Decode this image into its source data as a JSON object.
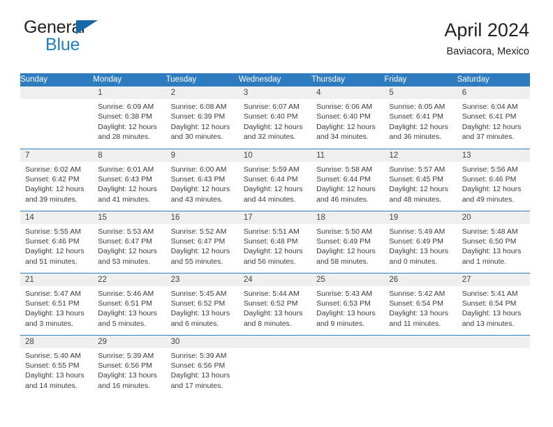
{
  "brand": {
    "name_top": "General",
    "name_bottom": "Blue",
    "logo_icon": "blue-triangle-icon",
    "accent_color": "#1f7ec4"
  },
  "header": {
    "title": "April 2024",
    "subtitle": "Baviacora, Mexico"
  },
  "calendar": {
    "header_bg": "#2e7cbf",
    "daynum_bg": "#efefef",
    "weekdays": [
      "Sunday",
      "Monday",
      "Tuesday",
      "Wednesday",
      "Thursday",
      "Friday",
      "Saturday"
    ],
    "weeks": [
      [
        {
          "day": "",
          "sunrise": "",
          "sunset": "",
          "daylight_1": "",
          "daylight_2": ""
        },
        {
          "day": "1",
          "sunrise": "Sunrise: 6:09 AM",
          "sunset": "Sunset: 6:38 PM",
          "daylight_1": "Daylight: 12 hours",
          "daylight_2": "and 28 minutes."
        },
        {
          "day": "2",
          "sunrise": "Sunrise: 6:08 AM",
          "sunset": "Sunset: 6:39 PM",
          "daylight_1": "Daylight: 12 hours",
          "daylight_2": "and 30 minutes."
        },
        {
          "day": "3",
          "sunrise": "Sunrise: 6:07 AM",
          "sunset": "Sunset: 6:40 PM",
          "daylight_1": "Daylight: 12 hours",
          "daylight_2": "and 32 minutes."
        },
        {
          "day": "4",
          "sunrise": "Sunrise: 6:06 AM",
          "sunset": "Sunset: 6:40 PM",
          "daylight_1": "Daylight: 12 hours",
          "daylight_2": "and 34 minutes."
        },
        {
          "day": "5",
          "sunrise": "Sunrise: 6:05 AM",
          "sunset": "Sunset: 6:41 PM",
          "daylight_1": "Daylight: 12 hours",
          "daylight_2": "and 36 minutes."
        },
        {
          "day": "6",
          "sunrise": "Sunrise: 6:04 AM",
          "sunset": "Sunset: 6:41 PM",
          "daylight_1": "Daylight: 12 hours",
          "daylight_2": "and 37 minutes."
        }
      ],
      [
        {
          "day": "7",
          "sunrise": "Sunrise: 6:02 AM",
          "sunset": "Sunset: 6:42 PM",
          "daylight_1": "Daylight: 12 hours",
          "daylight_2": "and 39 minutes."
        },
        {
          "day": "8",
          "sunrise": "Sunrise: 6:01 AM",
          "sunset": "Sunset: 6:43 PM",
          "daylight_1": "Daylight: 12 hours",
          "daylight_2": "and 41 minutes."
        },
        {
          "day": "9",
          "sunrise": "Sunrise: 6:00 AM",
          "sunset": "Sunset: 6:43 PM",
          "daylight_1": "Daylight: 12 hours",
          "daylight_2": "and 43 minutes."
        },
        {
          "day": "10",
          "sunrise": "Sunrise: 5:59 AM",
          "sunset": "Sunset: 6:44 PM",
          "daylight_1": "Daylight: 12 hours",
          "daylight_2": "and 44 minutes."
        },
        {
          "day": "11",
          "sunrise": "Sunrise: 5:58 AM",
          "sunset": "Sunset: 6:44 PM",
          "daylight_1": "Daylight: 12 hours",
          "daylight_2": "and 46 minutes."
        },
        {
          "day": "12",
          "sunrise": "Sunrise: 5:57 AM",
          "sunset": "Sunset: 6:45 PM",
          "daylight_1": "Daylight: 12 hours",
          "daylight_2": "and 48 minutes."
        },
        {
          "day": "13",
          "sunrise": "Sunrise: 5:56 AM",
          "sunset": "Sunset: 6:46 PM",
          "daylight_1": "Daylight: 12 hours",
          "daylight_2": "and 49 minutes."
        }
      ],
      [
        {
          "day": "14",
          "sunrise": "Sunrise: 5:55 AM",
          "sunset": "Sunset: 6:46 PM",
          "daylight_1": "Daylight: 12 hours",
          "daylight_2": "and 51 minutes."
        },
        {
          "day": "15",
          "sunrise": "Sunrise: 5:53 AM",
          "sunset": "Sunset: 6:47 PM",
          "daylight_1": "Daylight: 12 hours",
          "daylight_2": "and 53 minutes."
        },
        {
          "day": "16",
          "sunrise": "Sunrise: 5:52 AM",
          "sunset": "Sunset: 6:47 PM",
          "daylight_1": "Daylight: 12 hours",
          "daylight_2": "and 55 minutes."
        },
        {
          "day": "17",
          "sunrise": "Sunrise: 5:51 AM",
          "sunset": "Sunset: 6:48 PM",
          "daylight_1": "Daylight: 12 hours",
          "daylight_2": "and 56 minutes."
        },
        {
          "day": "18",
          "sunrise": "Sunrise: 5:50 AM",
          "sunset": "Sunset: 6:49 PM",
          "daylight_1": "Daylight: 12 hours",
          "daylight_2": "and 58 minutes."
        },
        {
          "day": "19",
          "sunrise": "Sunrise: 5:49 AM",
          "sunset": "Sunset: 6:49 PM",
          "daylight_1": "Daylight: 13 hours",
          "daylight_2": "and 0 minutes."
        },
        {
          "day": "20",
          "sunrise": "Sunrise: 5:48 AM",
          "sunset": "Sunset: 6:50 PM",
          "daylight_1": "Daylight: 13 hours",
          "daylight_2": "and 1 minute."
        }
      ],
      [
        {
          "day": "21",
          "sunrise": "Sunrise: 5:47 AM",
          "sunset": "Sunset: 6:51 PM",
          "daylight_1": "Daylight: 13 hours",
          "daylight_2": "and 3 minutes."
        },
        {
          "day": "22",
          "sunrise": "Sunrise: 5:46 AM",
          "sunset": "Sunset: 6:51 PM",
          "daylight_1": "Daylight: 13 hours",
          "daylight_2": "and 5 minutes."
        },
        {
          "day": "23",
          "sunrise": "Sunrise: 5:45 AM",
          "sunset": "Sunset: 6:52 PM",
          "daylight_1": "Daylight: 13 hours",
          "daylight_2": "and 6 minutes."
        },
        {
          "day": "24",
          "sunrise": "Sunrise: 5:44 AM",
          "sunset": "Sunset: 6:52 PM",
          "daylight_1": "Daylight: 13 hours",
          "daylight_2": "and 8 minutes."
        },
        {
          "day": "25",
          "sunrise": "Sunrise: 5:43 AM",
          "sunset": "Sunset: 6:53 PM",
          "daylight_1": "Daylight: 13 hours",
          "daylight_2": "and 9 minutes."
        },
        {
          "day": "26",
          "sunrise": "Sunrise: 5:42 AM",
          "sunset": "Sunset: 6:54 PM",
          "daylight_1": "Daylight: 13 hours",
          "daylight_2": "and 11 minutes."
        },
        {
          "day": "27",
          "sunrise": "Sunrise: 5:41 AM",
          "sunset": "Sunset: 6:54 PM",
          "daylight_1": "Daylight: 13 hours",
          "daylight_2": "and 13 minutes."
        }
      ],
      [
        {
          "day": "28",
          "sunrise": "Sunrise: 5:40 AM",
          "sunset": "Sunset: 6:55 PM",
          "daylight_1": "Daylight: 13 hours",
          "daylight_2": "and 14 minutes."
        },
        {
          "day": "29",
          "sunrise": "Sunrise: 5:39 AM",
          "sunset": "Sunset: 6:56 PM",
          "daylight_1": "Daylight: 13 hours",
          "daylight_2": "and 16 minutes."
        },
        {
          "day": "30",
          "sunrise": "Sunrise: 5:39 AM",
          "sunset": "Sunset: 6:56 PM",
          "daylight_1": "Daylight: 13 hours",
          "daylight_2": "and 17 minutes."
        },
        {
          "day": "",
          "sunrise": "",
          "sunset": "",
          "daylight_1": "",
          "daylight_2": ""
        },
        {
          "day": "",
          "sunrise": "",
          "sunset": "",
          "daylight_1": "",
          "daylight_2": ""
        },
        {
          "day": "",
          "sunrise": "",
          "sunset": "",
          "daylight_1": "",
          "daylight_2": ""
        },
        {
          "day": "",
          "sunrise": "",
          "sunset": "",
          "daylight_1": "",
          "daylight_2": ""
        }
      ]
    ]
  }
}
